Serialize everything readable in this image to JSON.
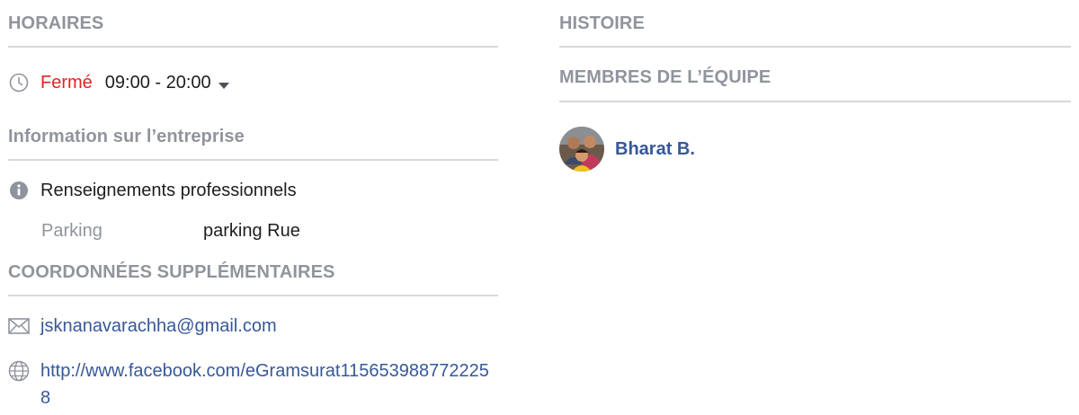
{
  "left": {
    "hours_header": "HORAIRES",
    "status": "Fermé",
    "hours": "09:00 - 20:00",
    "business_info_header": "Information sur l’entreprise",
    "business_details_label": "Renseignements professionnels",
    "parking_label": "Parking",
    "parking_value": "parking Rue",
    "contact_header": "COORDONNÉES SUPPLÉMENTAIRES",
    "email": "jsknanavarachha@gmail.com",
    "website": "http://www.facebook.com/eGramsurat1156539887722258"
  },
  "right": {
    "story_header": "HISTOIRE",
    "team_header": "MEMBRES DE L’ÉQUIPE",
    "members": [
      {
        "name": "Bharat B."
      }
    ]
  },
  "colors": {
    "header_gray": "#90949c",
    "divider": "#d6d8dc",
    "closed_red": "#e02424",
    "link_blue": "#365899",
    "text": "#1c1e21"
  },
  "icons": {
    "hours": "clock-icon",
    "info": "info-icon",
    "email": "envelope-icon",
    "website": "globe-icon",
    "dropdown": "caret-down-icon"
  }
}
